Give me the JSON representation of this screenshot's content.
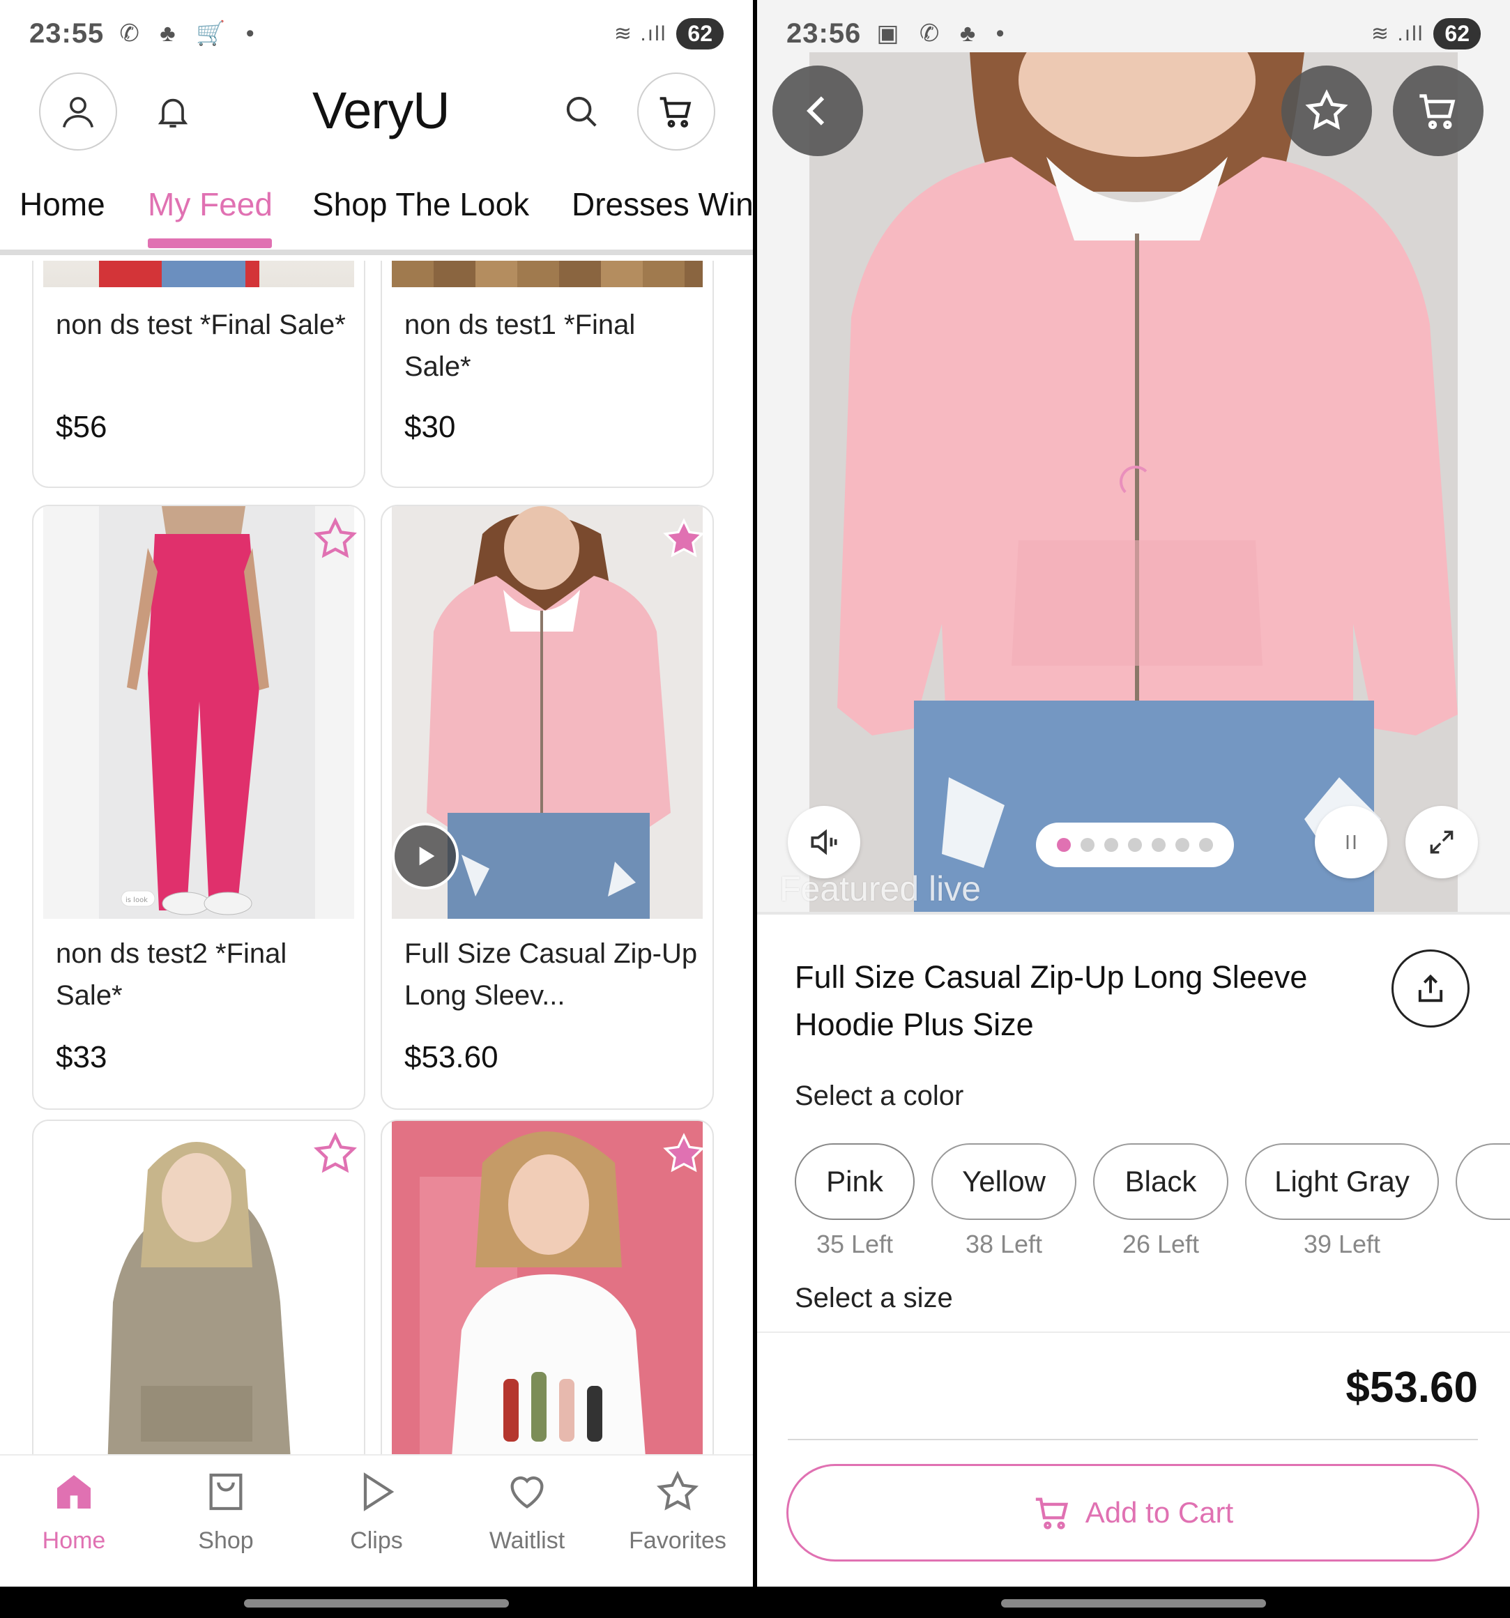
{
  "left": {
    "status": {
      "time": "23:55",
      "battery": "62"
    },
    "header": {
      "logo": "VeryU"
    },
    "tabs": [
      "Home",
      "My Feed",
      "Shop The Look",
      "Dresses Win"
    ],
    "products": [
      {
        "name": "non ds test *Final Sale*",
        "price": "$56"
      },
      {
        "name": "non ds test1 *Final Sale*",
        "price": "$30"
      },
      {
        "name": "non ds test2 *Final Sale*",
        "price": "$33",
        "image_caption": "is look"
      },
      {
        "name": "Full Size Casual Zip-Up Long Sleev...",
        "price": "$53.60"
      }
    ],
    "bottom_nav": [
      "Home",
      "Shop",
      "Clips",
      "Waitlist",
      "Favorites"
    ],
    "colors": {
      "accent": "#e071b2"
    }
  },
  "right": {
    "status": {
      "time": "23:56",
      "battery": "62"
    },
    "overlay_text": "Featured live",
    "product_title": "Full Size Casual Zip-Up Long Sleeve Hoodie Plus Size",
    "select_color_label": "Select a color",
    "colors": [
      {
        "name": "Pink",
        "left": "35 Left"
      },
      {
        "name": "Yellow",
        "left": "38 Left"
      },
      {
        "name": "Black",
        "left": "26 Left"
      },
      {
        "name": "Light Gray",
        "left": "39 Left"
      }
    ],
    "select_size_label": "Select a size",
    "price": "$53.60",
    "add_to_cart": "Add to Cart"
  }
}
